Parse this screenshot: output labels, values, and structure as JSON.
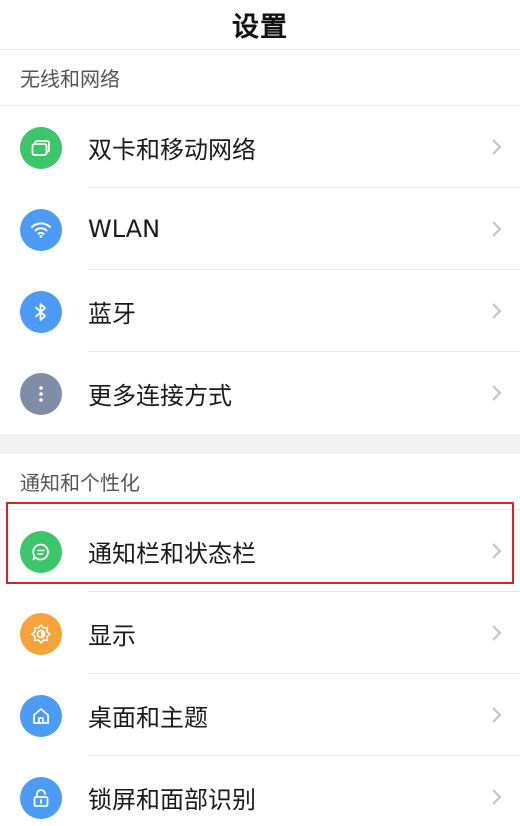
{
  "header": {
    "title": "设置"
  },
  "sections": [
    {
      "header": "无线和网络",
      "items": [
        {
          "label": "双卡和移动网络",
          "icon": "sim-card-icon",
          "color": "#3cc56b"
        },
        {
          "label": "WLAN",
          "icon": "wifi-icon",
          "color": "#4c9bf5"
        },
        {
          "label": "蓝牙",
          "icon": "bluetooth-icon",
          "color": "#4c9bf5"
        },
        {
          "label": "更多连接方式",
          "icon": "more-dots-icon",
          "color": "#7f8da8"
        }
      ]
    },
    {
      "header": "通知和个性化",
      "items": [
        {
          "label": "通知栏和状态栏",
          "icon": "notification-bubble-icon",
          "color": "#3cc56b"
        },
        {
          "label": "显示",
          "icon": "brightness-icon",
          "color": "#f7a33b"
        },
        {
          "label": "桌面和主题",
          "icon": "home-icon",
          "color": "#4c9bf5"
        },
        {
          "label": "锁屏和面部识别",
          "icon": "lock-icon",
          "color": "#4c9bf5"
        }
      ]
    }
  ],
  "highlight": {
    "color": "#e02020"
  }
}
